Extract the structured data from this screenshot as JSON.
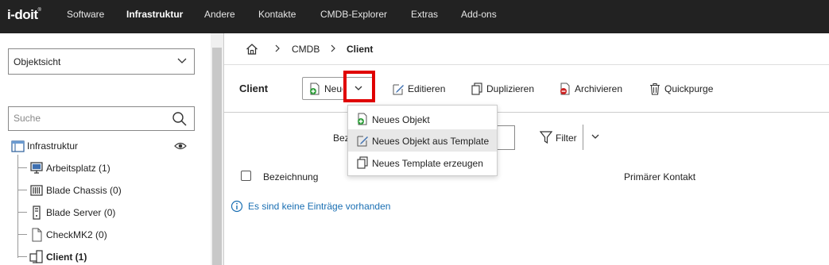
{
  "app": {
    "logo": "i-doit",
    "logo_sup": "®"
  },
  "topnav": {
    "items": [
      {
        "label": "Software"
      },
      {
        "label": "Infrastruktur",
        "active": true
      },
      {
        "label": "Andere"
      },
      {
        "label": "Kontakte"
      },
      {
        "label": "CMDB-Explorer"
      },
      {
        "label": "Extras"
      },
      {
        "label": "Add-ons"
      }
    ]
  },
  "sidebar": {
    "view_select": {
      "value": "Objektsicht"
    },
    "search": {
      "placeholder": "Suche"
    },
    "tree": {
      "root": {
        "label": "Infrastruktur"
      },
      "items": [
        {
          "label": "Arbeitsplatz (1)",
          "icon": "workstation-icon"
        },
        {
          "label": "Blade Chassis (0)",
          "icon": "blade-chassis-icon"
        },
        {
          "label": "Blade Server (0)",
          "icon": "blade-server-icon"
        },
        {
          "label": "CheckMK2 (0)",
          "icon": "document-icon"
        },
        {
          "label": "Client (1)",
          "icon": "client-icon",
          "active": true
        }
      ]
    }
  },
  "breadcrumb": {
    "items": [
      "CMDB",
      "Client"
    ]
  },
  "toolbar": {
    "title": "Client",
    "new_label": "Neues Objekt",
    "edit_label": "Editieren",
    "duplicate_label": "Duplizieren",
    "archive_label": "Archivieren",
    "quickpurge_label": "Quickpurge"
  },
  "dropdown": {
    "items": [
      {
        "label": "Neues Objekt",
        "icon": "add-icon"
      },
      {
        "label": "Neues Objekt aus Template",
        "icon": "edit-icon",
        "hover": true
      },
      {
        "label": "Neues Template erzeugen",
        "icon": "copy-icon"
      }
    ]
  },
  "filterbar": {
    "label_partial": "Bez",
    "filter_label": "Filter"
  },
  "table": {
    "columns": [
      "Bezeichnung",
      "Primärer Kontakt"
    ],
    "empty_message": "Es sind keine Einträge vorhanden"
  },
  "colors": {
    "topbar": "#222222",
    "highlight": "#e00000",
    "info": "#1a6fb3",
    "add_green": "#2e9e3a",
    "archive_red": "#cc2222"
  }
}
